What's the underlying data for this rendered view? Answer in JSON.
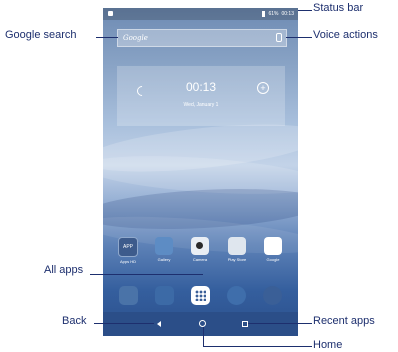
{
  "status_bar": {
    "battery": "61%",
    "time": "00:13"
  },
  "search": {
    "logo": "Google"
  },
  "clock_widget": {
    "time": "00:13",
    "date": "Wed, January 1"
  },
  "apps": [
    {
      "label": "Apps HD",
      "icon_text": "APP"
    },
    {
      "label": "Gallery"
    },
    {
      "label": "Camera"
    },
    {
      "label": "Play Store"
    },
    {
      "label": "Google"
    }
  ],
  "callouts": {
    "status_bar": "Status bar",
    "google_search": "Google search",
    "voice_actions": "Voice actions",
    "all_apps": "All apps",
    "back": "Back",
    "recent_apps": "Recent apps",
    "home": "Home"
  },
  "icons": {
    "dock": [
      "contacts-icon",
      "mail-icon",
      "all-apps-icon",
      "browser-icon",
      "music-icon"
    ],
    "nav": [
      "back-icon",
      "home-icon",
      "recent-apps-icon"
    ]
  },
  "colors": {
    "callout_text": "#1d2f6e",
    "nav_bar": "#2b4e88"
  }
}
